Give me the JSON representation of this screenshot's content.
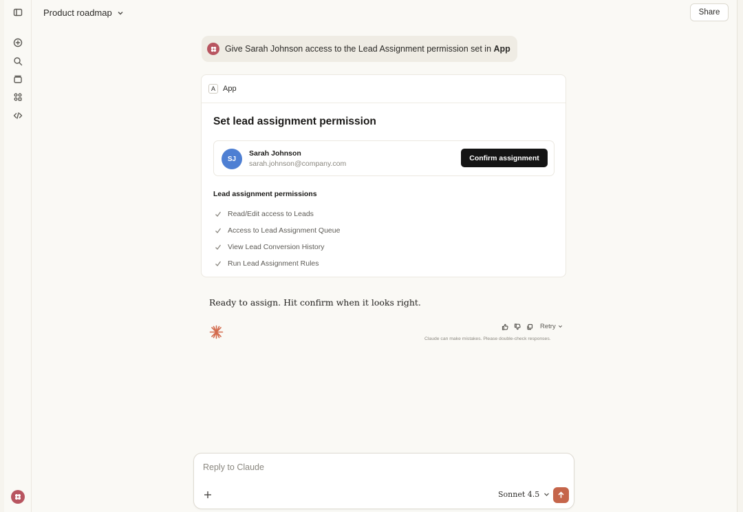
{
  "header": {
    "title": "Product roadmap",
    "share_label": "Share"
  },
  "conversation": {
    "user_message_prefix": "Give Sarah Johnson access to the Lead Assignment permission set in ",
    "user_message_app": "App",
    "assistant_reply": "Ready to assign. Hit confirm when it looks right."
  },
  "app_card": {
    "badge": "A",
    "app_name": "App",
    "title": "Set lead assignment permission",
    "user": {
      "initials": "SJ",
      "name": "Sarah Johnson",
      "email": "sarah.johnson@company.com"
    },
    "confirm_label": "Confirm assignment",
    "permissions_title": "Lead assignment permissions",
    "permissions": [
      "Read/Edit access to Leads",
      "Access to Lead Assignment Queue",
      "View Lead Conversion History",
      "Run Lead Assignment Rules"
    ]
  },
  "message_actions": {
    "retry_label": "Retry",
    "disclaimer": "Claude can make mistakes. Please double-check responses."
  },
  "composer": {
    "placeholder": "Reply to Claude",
    "model": "Sonnet 4.5"
  },
  "colors": {
    "accent": "#c5654a",
    "avatar": "#b85560",
    "user_avatar": "#4e7fd3",
    "background": "#faf9f5"
  },
  "icons": {
    "sidebar": [
      "sidebar-toggle-icon",
      "new-chat-icon",
      "search-icon",
      "projects-icon",
      "artifacts-icon",
      "code-icon"
    ]
  }
}
